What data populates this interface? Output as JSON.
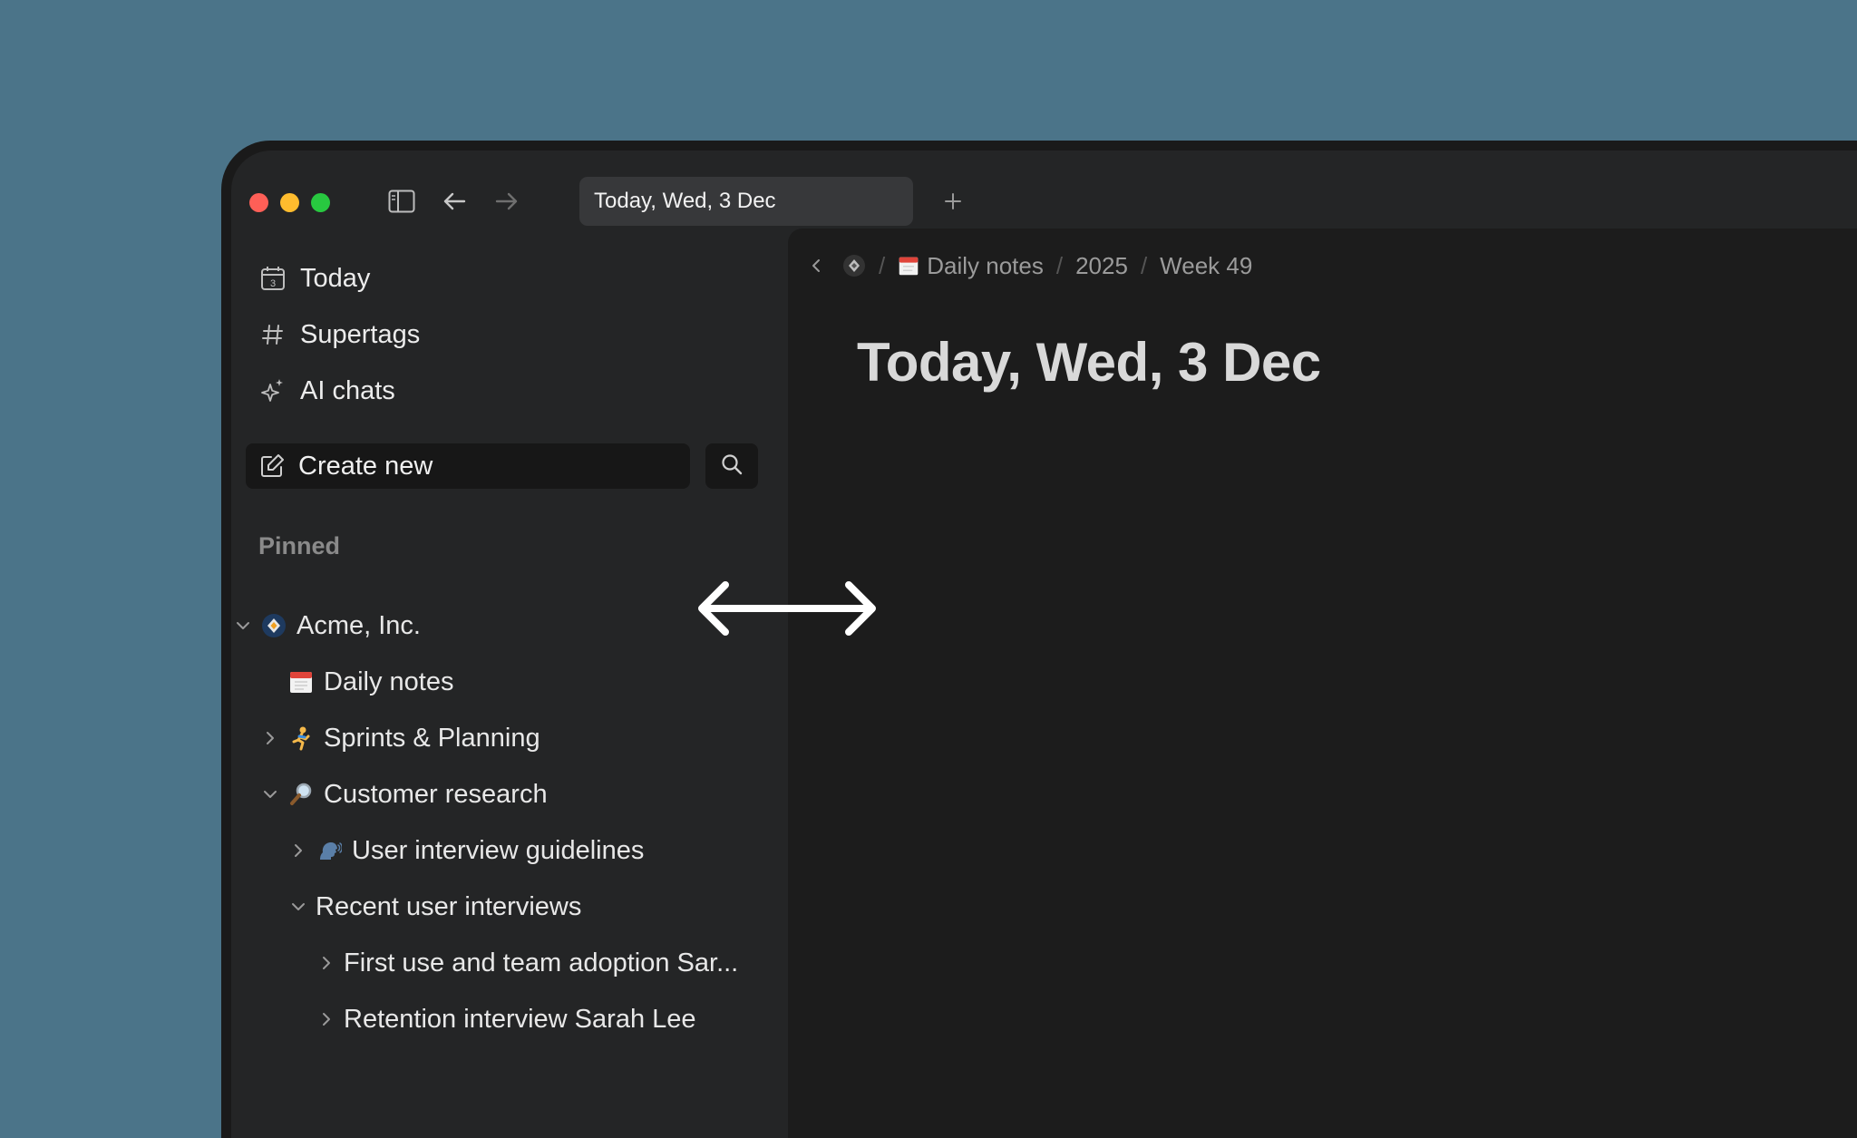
{
  "window": {
    "tab_title": "Today, Wed, 3 Dec"
  },
  "sidebar": {
    "nav": [
      {
        "label": "Today",
        "icon": "calendar-icon",
        "badge": "3"
      },
      {
        "label": "Supertags",
        "icon": "hash-icon"
      },
      {
        "label": "AI chats",
        "icon": "sparkle-icon"
      }
    ],
    "create_label": "Create new",
    "section_label": "Pinned",
    "tree": [
      {
        "label": "Acme, Inc.",
        "icon": "workspace-logo-icon",
        "expanded": true
      },
      {
        "label": "Daily notes",
        "icon": "calendar-emoji-icon"
      },
      {
        "label": "Sprints & Planning",
        "icon": "runner-emoji-icon",
        "expanded": false
      },
      {
        "label": "Customer research",
        "icon": "magnifier-emoji-icon",
        "expanded": true
      },
      {
        "label": "User interview guidelines",
        "icon": "speaking-head-emoji-icon",
        "expanded": false
      },
      {
        "label": "Recent user interviews",
        "expanded": true
      },
      {
        "label": "First use and team adoption Sar...",
        "expanded": false
      },
      {
        "label": "Retention interview Sarah Lee",
        "expanded": false
      }
    ]
  },
  "main": {
    "breadcrumbs": [
      "Daily notes",
      "2025",
      "Week 49"
    ],
    "title": "Today, Wed, 3 Dec"
  },
  "colors": {
    "background": "#4b7489",
    "sidebar": "#242526",
    "main": "#1c1c1c"
  }
}
